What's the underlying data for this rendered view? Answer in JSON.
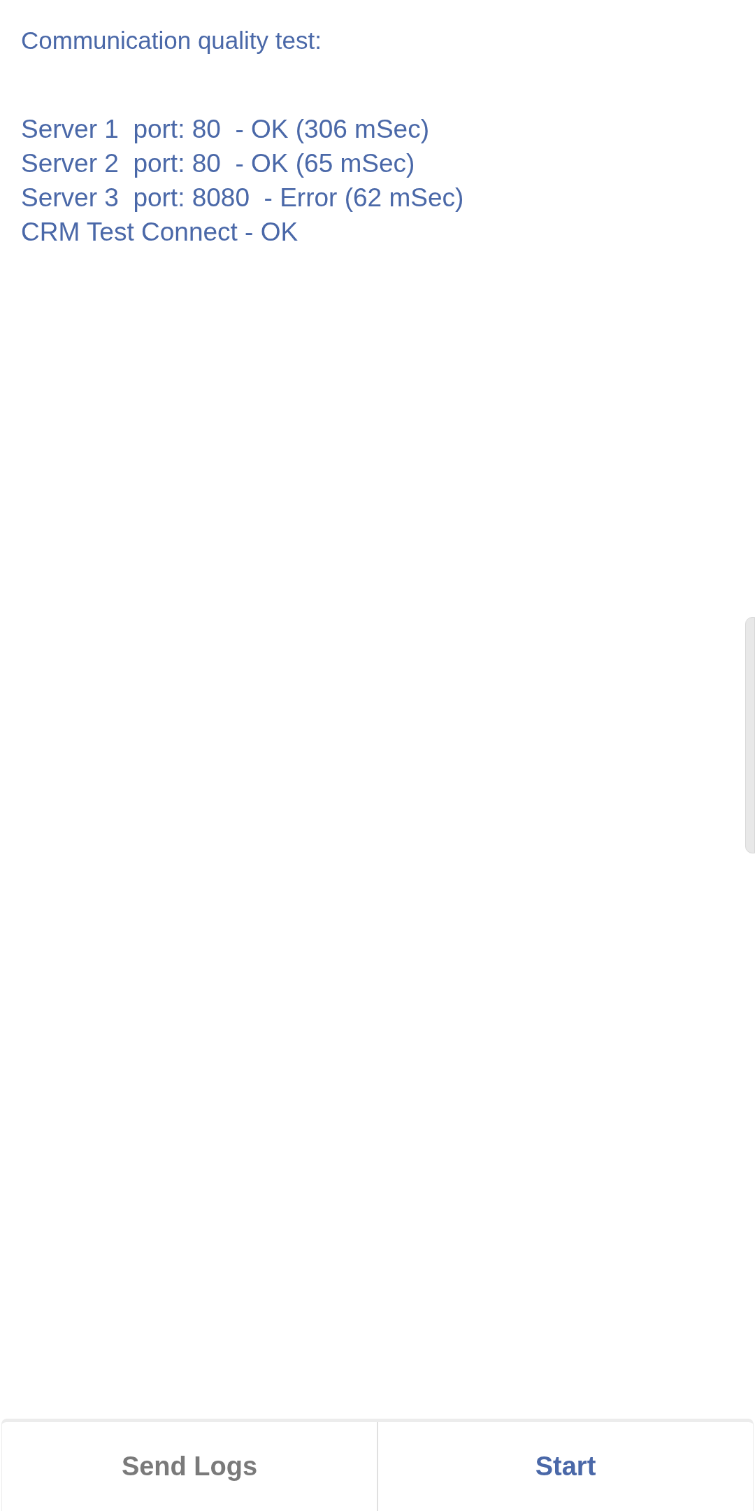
{
  "title": "Communication quality test:",
  "results": [
    "Server 1  port: 80  - OK (306 mSec)",
    "Server 2  port: 80  - OK (65 mSec)",
    "Server 3  port: 8080  - Error (62 mSec)",
    "CRM Test Connect - OK"
  ],
  "buttons": [
    {
      "label": "Send Logs",
      "kind": "secondary"
    },
    {
      "label": "Start",
      "kind": "primary"
    }
  ]
}
